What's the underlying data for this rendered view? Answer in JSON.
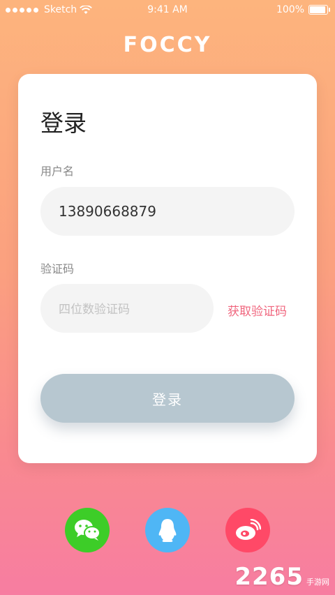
{
  "status_bar": {
    "carrier": "Sketch",
    "time": "9:41 AM",
    "battery_percent": "100%",
    "battery_level": 1.0
  },
  "brand": {
    "logo_text": "FOCCY"
  },
  "login_card": {
    "title": "登录",
    "username": {
      "label": "用户名",
      "value": "13890668879"
    },
    "code": {
      "label": "验证码",
      "placeholder": "四位数验证码",
      "value": "",
      "get_code_label": "获取验证码"
    },
    "submit_label": "登录"
  },
  "social_login": {
    "items": [
      {
        "name": "wechat",
        "icon": "wechat-icon",
        "color": "#3dcd28"
      },
      {
        "name": "qq",
        "icon": "qq-penguin-icon",
        "color": "#4fb6f5"
      },
      {
        "name": "weibo",
        "icon": "weibo-icon",
        "color": "#ff4967"
      }
    ]
  },
  "watermark": {
    "number": "2265",
    "text": "手游网"
  },
  "colors": {
    "accent": "#f0667e",
    "button_disabled": "#b7c7d0",
    "gradient_top": "#fdb47d",
    "gradient_bottom": "#f77da1"
  }
}
